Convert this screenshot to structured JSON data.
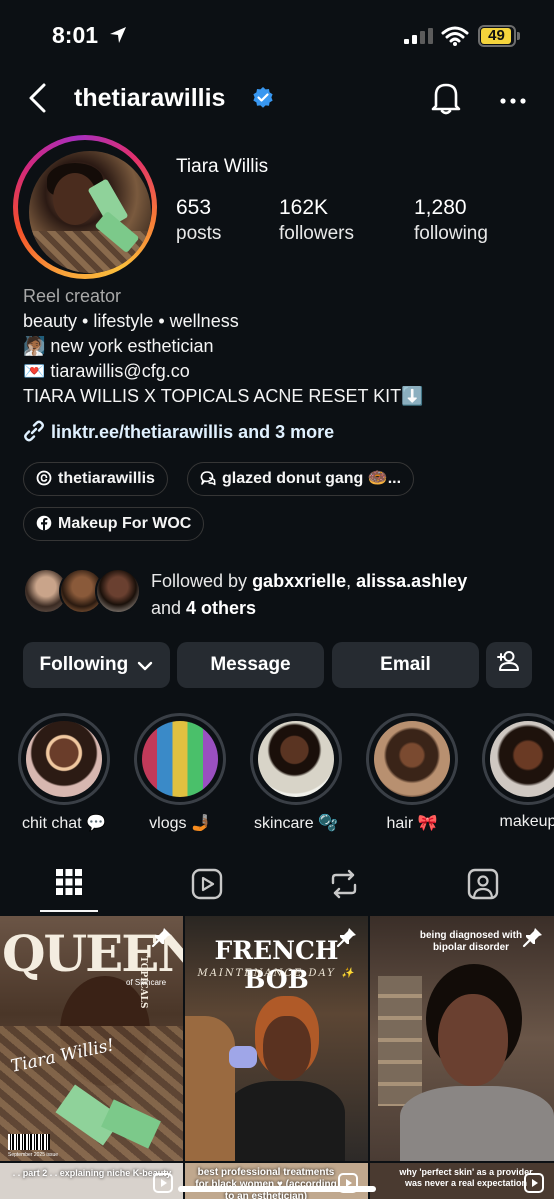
{
  "status": {
    "time": "8:01",
    "battery": "49"
  },
  "header": {
    "username": "thetiarawillis"
  },
  "profile": {
    "name": "Tiara Willis",
    "stats": [
      {
        "value": "653",
        "label": "posts"
      },
      {
        "value": "162K",
        "label": "followers"
      },
      {
        "value": "1,280",
        "label": "following"
      }
    ],
    "category": "Reel creator",
    "bio": [
      "beauty • lifestyle • wellness",
      "🧖🏾 new york esthetician",
      "💌 tiarawillis@cfg.co",
      "TIARA WILLIS X TOPICALS ACNE RESET KIT⬇️"
    ],
    "link": "linktr.ee/thetiarawillis and 3 more",
    "chips": {
      "threads": "thetiarawillis",
      "group": "glazed donut gang 🍩...",
      "facebook": "Makeup For WOC"
    },
    "followed_by": {
      "prefix": "Followed by ",
      "user1": "gabxxrielle",
      "sep": ", ",
      "user2": "alissa.ashley",
      "and": "and ",
      "others": "4 others"
    }
  },
  "buttons": {
    "following": "Following",
    "message": "Message",
    "email": "Email"
  },
  "highlights": [
    {
      "label": "chit chat 💬"
    },
    {
      "label": "vlogs 🤳🏾"
    },
    {
      "label": "skincare 🫧"
    },
    {
      "label": "hair 🎀"
    },
    {
      "label": "makeup"
    }
  ],
  "posts": {
    "p1_title": "QUEEN",
    "p1_side": "TOPICALS",
    "p1_sub": "of Skincare",
    "p1_sign": "Tiara Willis!",
    "p1_issue": "September 2025 issue",
    "p2_title": "FRENCH BOB",
    "p2_sub": "MAINTENANCE DAY ✨",
    "p3_title": "being diagnosed with bipolar disorder",
    "p4_title": ". . part 2 . . explaining niche K-beauty",
    "p5_title": "best professional treatments for black women ♥ (according to an esthetician)",
    "p6_title": "why 'perfect skin' as a provider was never a real expectation"
  }
}
